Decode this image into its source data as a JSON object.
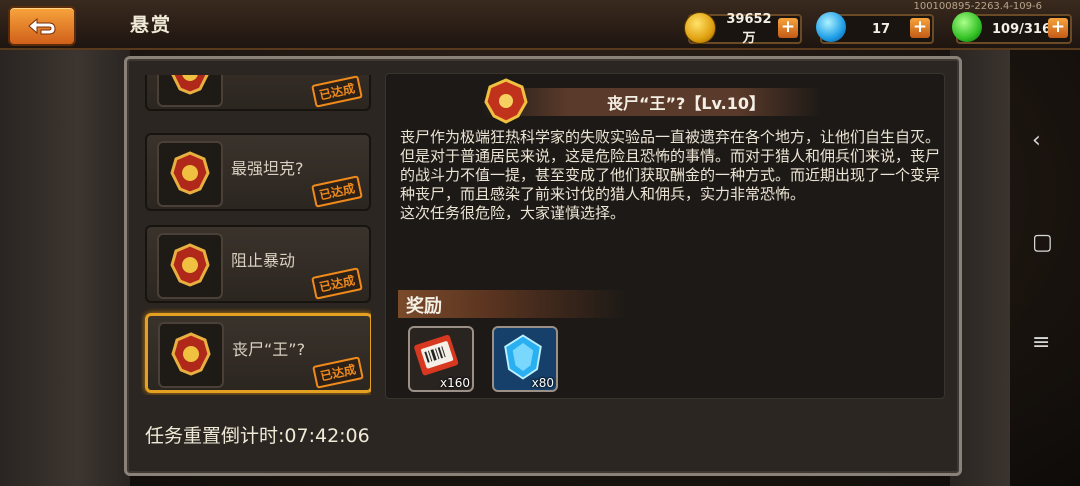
{
  "header": {
    "title": "悬赏",
    "version": "100100895-2263.4-109-6"
  },
  "resources": [
    {
      "id": "gold",
      "icon": "gold-coin-icon",
      "value": "39652万"
    },
    {
      "id": "gem",
      "icon": "blue-gem-icon",
      "value": "17"
    },
    {
      "id": "stamina",
      "icon": "green-crystal-icon",
      "value": "109/316"
    }
  ],
  "tasks": [
    {
      "name": "",
      "status": "已达成",
      "selected": false
    },
    {
      "name": "最强坦克?",
      "status": "已达成",
      "selected": false
    },
    {
      "name": "阻止暴动",
      "status": "已达成",
      "selected": false
    },
    {
      "name": "丧尸“王”?",
      "status": "已达成",
      "selected": true
    }
  ],
  "countdown": "任务重置倒计时:07:42:06",
  "detail": {
    "title": "丧尸“王”?【Lv.10】",
    "description": "丧尸作为极端狂热科学家的失败实验品一直被遗弃在各个地方，让他们自生自灭。但是对于普通居民来说，这是危险且恐怖的事情。而对于猎人和佣兵们来说，丧尸的战斗力不值一提，甚至变成了他们获取酬金的一种方式。而近期出现了一个变异种丧尸，而且感染了前来讨伐的猎人和佣兵，实力非常恐怖。\n这次任务很危险，大家谨慎选择。",
    "reward_label": "奖励",
    "rewards": [
      {
        "icon": "ticket-icon",
        "qty": "x160"
      },
      {
        "icon": "blue-gem-icon",
        "qty": "x80"
      }
    ]
  },
  "colors": {
    "accent": "#ef8a1c",
    "selected_border": "#e4a020"
  }
}
